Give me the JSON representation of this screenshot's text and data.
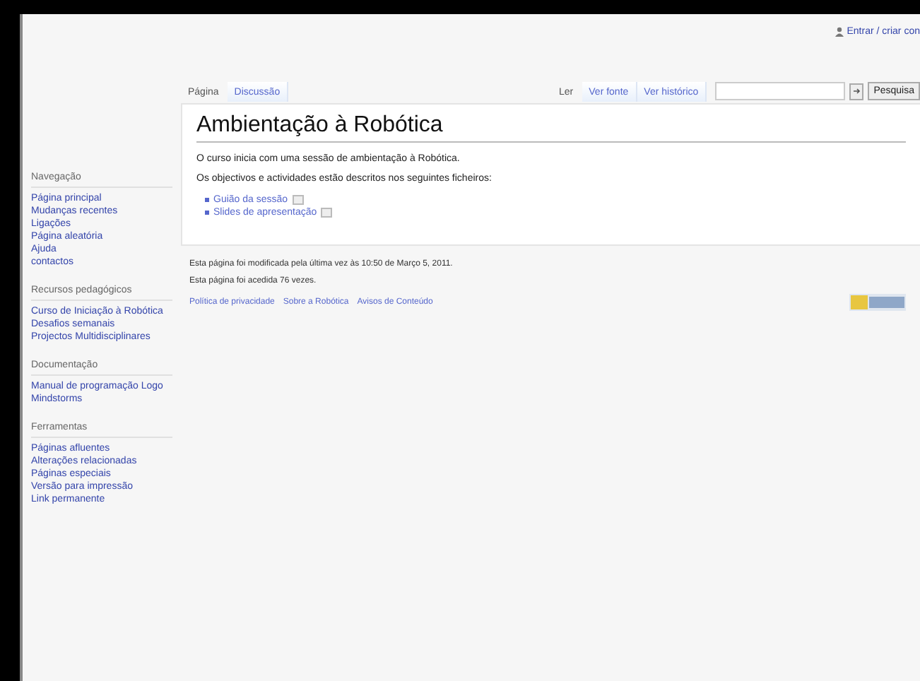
{
  "personal_tools": [
    "Entrar / criar con"
  ],
  "namespace_tabs": [
    {
      "label": "Página",
      "selected": true
    },
    {
      "label": "Discussão",
      "selected": false
    }
  ],
  "view_tabs": [
    {
      "label": "Ler",
      "selected": true
    },
    {
      "label": "Ver fonte",
      "selected": false
    },
    {
      "label": "Ver histórico",
      "selected": false
    }
  ],
  "search": {
    "button": "Pesquisa"
  },
  "sidebar": [
    {
      "heading": "Navegação",
      "items": [
        "Página principal",
        "Mudanças recentes",
        "Ligações",
        "Página aleatória",
        "Ajuda",
        "contactos"
      ]
    },
    {
      "heading": "Recursos pedagógicos",
      "items": [
        "Curso de Iniciação à Robótica",
        "Desafios semanais",
        "Projectos Multidisciplinares"
      ]
    },
    {
      "heading": "Documentação",
      "items": [
        "Manual de programação Logo Mindstorms"
      ]
    },
    {
      "heading": "Ferramentas",
      "items": [
        "Páginas afluentes",
        "Alterações relacionadas",
        "Páginas especiais",
        "Versão para impressão",
        "Link permanente"
      ]
    }
  ],
  "page": {
    "title": "Ambientação à Robótica",
    "paragraphs": [
      "O curso inicia com uma sessão de ambientação à Robótica.",
      "Os objectivos e actividades estão descritos nos seguintes ficheiros:"
    ],
    "files": [
      "Guião da sessão",
      "Slides de apresentação"
    ]
  },
  "footer": {
    "lines": [
      "Esta página foi modificada pela última vez às 10:50 de Março 5, 2011.",
      "Esta página foi acedida 76 vezes."
    ],
    "links": [
      "Política de privacidade",
      "Sobre a Robótica",
      "Avisos de Conteúdo"
    ]
  }
}
